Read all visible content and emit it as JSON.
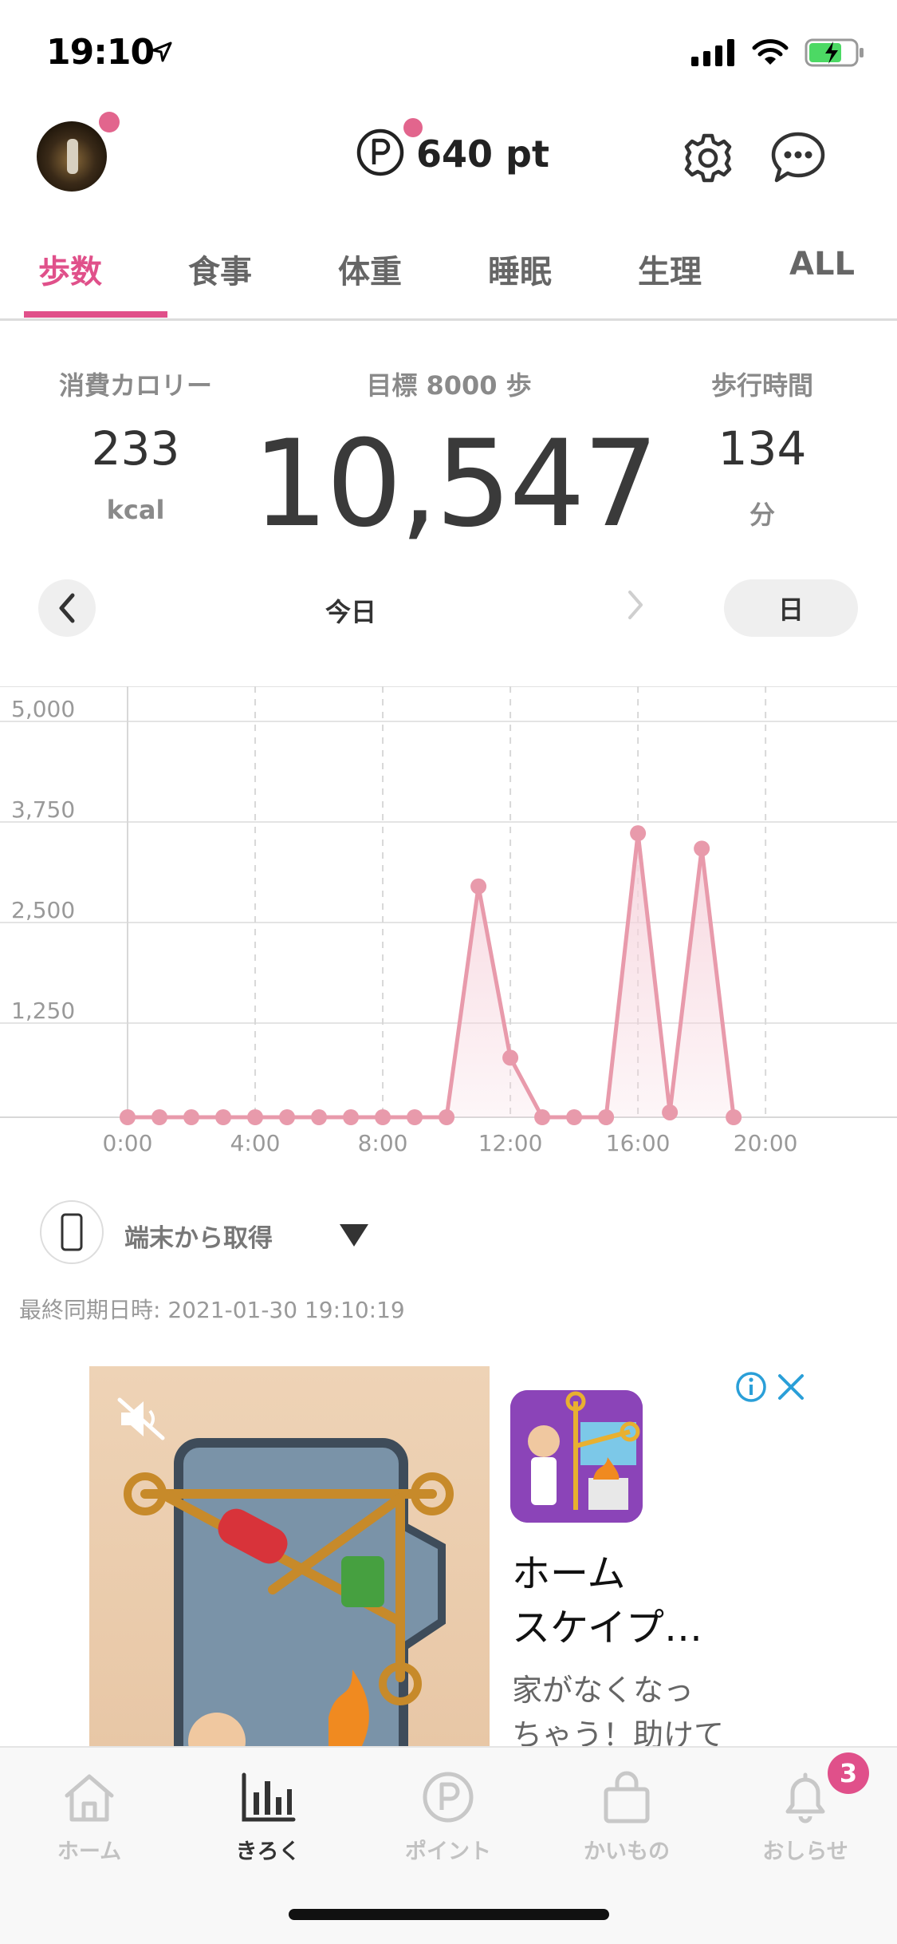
{
  "status_bar": {
    "time": "19:10"
  },
  "header": {
    "points": "640 pt"
  },
  "tabs": [
    {
      "label": "歩数",
      "active": true
    },
    {
      "label": "食事"
    },
    {
      "label": "体重"
    },
    {
      "label": "睡眠"
    },
    {
      "label": "生理"
    },
    {
      "label": "ALL"
    }
  ],
  "stats": {
    "calories": {
      "label": "消費カロリー",
      "value": "233",
      "unit": "kcal"
    },
    "goal_label": "目標 8000 歩",
    "steps": "10,547",
    "walk_time": {
      "label": "歩行時間",
      "value": "134",
      "unit": "分"
    }
  },
  "date_nav": {
    "label": "今日",
    "period": "日"
  },
  "chart_data": {
    "type": "line",
    "x_labels": [
      "0:00",
      "4:00",
      "8:00",
      "12:00",
      "16:00",
      "20:00"
    ],
    "y_labels": [
      "5,000",
      "3,750",
      "2,500",
      "1,250"
    ],
    "ylim": [
      0,
      5000
    ],
    "xlim": [
      0,
      24
    ],
    "grid": true,
    "color": "#e89aab",
    "fill_color": "#f6d3dc",
    "points": [
      {
        "x": 0,
        "y": 0
      },
      {
        "x": 1,
        "y": 0
      },
      {
        "x": 2,
        "y": 0
      },
      {
        "x": 3,
        "y": 0
      },
      {
        "x": 4,
        "y": 0
      },
      {
        "x": 5,
        "y": 0
      },
      {
        "x": 6,
        "y": 0
      },
      {
        "x": 7,
        "y": 0
      },
      {
        "x": 8,
        "y": 0
      },
      {
        "x": 9,
        "y": 0
      },
      {
        "x": 10,
        "y": 0
      },
      {
        "x": 11,
        "y": 2870
      },
      {
        "x": 12,
        "y": 740
      },
      {
        "x": 13,
        "y": 0
      },
      {
        "x": 14,
        "y": 0
      },
      {
        "x": 15,
        "y": 0
      },
      {
        "x": 16,
        "y": 3530
      },
      {
        "x": 17,
        "y": 60
      },
      {
        "x": 18,
        "y": 3340
      },
      {
        "x": 19,
        "y": 0
      }
    ]
  },
  "source": {
    "label": "端末から取得",
    "sync": "最終同期日時:  2021-01-30 19:10:19"
  },
  "ad": {
    "title_line1": "ホーム",
    "title_line2": "スケイプ…",
    "desc_line1": "家がなくなっ",
    "desc_line2": "ちゃう！助けて"
  },
  "bottom_nav": [
    {
      "label": "ホーム"
    },
    {
      "label": "きろく",
      "active": true
    },
    {
      "label": "ポイント"
    },
    {
      "label": "かいもの"
    },
    {
      "label": "おしらせ",
      "badge": "3"
    }
  ]
}
